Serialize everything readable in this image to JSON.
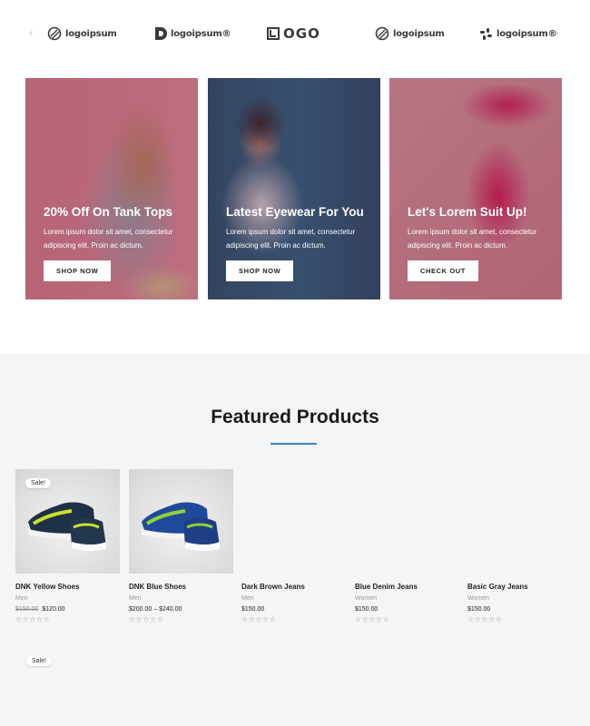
{
  "logos": [
    {
      "text": "logoipsum"
    },
    {
      "text": "logoipsum®"
    },
    {
      "text": "OGO"
    },
    {
      "text": "logoipsum"
    },
    {
      "text": "logoipsum®"
    }
  ],
  "carousel": {
    "prev_icon": "chevron-left-icon",
    "next_icon": "chevron-right-icon"
  },
  "banners": [
    {
      "title": "20% Off On Tank Tops",
      "text": "Lorem ipsum dolor sit amet, consectetur adipiscing elit. Proin ac dictum.",
      "button": "SHOP NOW"
    },
    {
      "title": "Latest Eyewear For You",
      "text": "Lorem ipsum dolor sit amet, consectetur adipiscing elit. Proin ac dictum.",
      "button": "SHOP NOW"
    },
    {
      "title": "Let's Lorem Suit Up!",
      "text": "Lorem ipsum dolor sit amet, consectetur adipiscing elit. Proin ac dictum.",
      "button": "CHECK OUT"
    }
  ],
  "featured": {
    "title": "Featured Products",
    "products": [
      {
        "name": "DNK Yellow Shoes",
        "category": "Men",
        "old_price": "$150.00",
        "price": "$120.00",
        "sale": "Sale!",
        "stars": "☆☆☆☆☆"
      },
      {
        "name": "DNK Blue Shoes",
        "category": "Men",
        "price": "$200.00 – $240.00",
        "stars": "☆☆☆☆☆"
      },
      {
        "name": "Dark Brown Jeans",
        "category": "Men",
        "price": "$150.00",
        "stars": "☆☆☆☆☆"
      },
      {
        "name": "Blue Denim Jeans",
        "category": "Women",
        "price": "$150.00",
        "stars": "☆☆☆☆☆"
      },
      {
        "name": "Basic Gray Jeans",
        "category": "Women",
        "price": "$150.00",
        "stars": "☆☆☆☆☆"
      }
    ],
    "next_row_sale": "Sale!"
  },
  "colors": {
    "accent": "#3a86c0",
    "banner_overlay": "#5f1e37",
    "section_bg": "#f4f5f7"
  }
}
